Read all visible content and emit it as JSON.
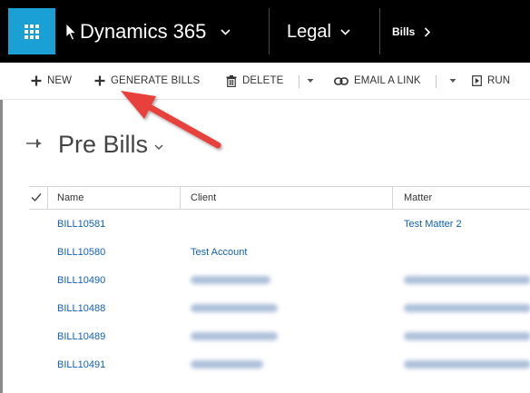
{
  "topnav": {
    "app_name": "Dynamics 365",
    "area": "Legal",
    "breadcrumb": "Bills",
    "colors": {
      "bar": "#000000",
      "waffle": "#1ba0d6"
    }
  },
  "commandbar": {
    "new_label": "NEW",
    "generate_label": "GENERATE BILLS",
    "delete_label": "DELETE",
    "email_label": "EMAIL A LINK",
    "run_label": "RUN"
  },
  "page": {
    "title": "Pre Bills"
  },
  "grid": {
    "columns": [
      "Name",
      "Client",
      "Matter"
    ],
    "rows": [
      {
        "name": "BILL10581",
        "client": "",
        "matter": "Test Matter 2"
      },
      {
        "name": "BILL10580",
        "client": "Test Account",
        "matter": ""
      },
      {
        "name": "BILL10490",
        "client": "",
        "matter": ""
      },
      {
        "name": "BILL10488",
        "client": "",
        "matter": ""
      },
      {
        "name": "BILL10489",
        "client": "",
        "matter": ""
      },
      {
        "name": "BILL10491",
        "client": "",
        "matter": ""
      }
    ]
  },
  "annotation": {
    "arrow_color": "#e8413c"
  }
}
